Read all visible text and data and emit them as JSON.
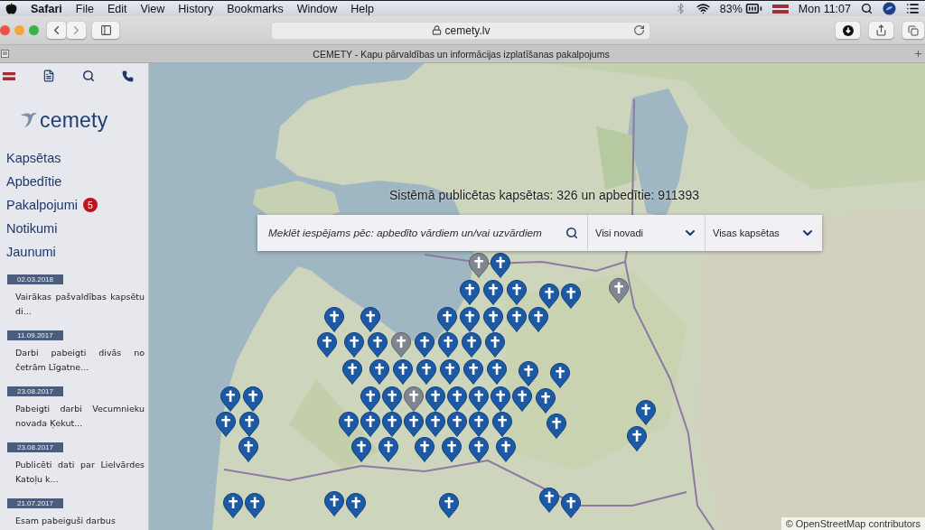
{
  "menu_bar": {
    "app": "Safari",
    "menus": [
      "File",
      "Edit",
      "View",
      "History",
      "Bookmarks",
      "Window",
      "Help"
    ],
    "battery": "83%",
    "clock": "Mon 11:07"
  },
  "toolbar": {
    "address": "cemety.lv"
  },
  "tab": {
    "title": "CEMETY - Kapu pārvaldības un informācijas izplatīšanas pakalpojums"
  },
  "sidebar": {
    "logo": "cemety",
    "nav": [
      {
        "label": "Kapsētas"
      },
      {
        "label": "Apbedītie"
      },
      {
        "label": "Pakalpojumi",
        "badge": "5"
      },
      {
        "label": "Notikumi"
      },
      {
        "label": "Jaunumi"
      }
    ],
    "news": [
      {
        "date": "02.03.2018",
        "text": "Vairākas pašvaldības kapsētu di..."
      },
      {
        "date": "11.09.2017",
        "text": "Darbi pabeigti divās no četrām Līgatne..."
      },
      {
        "date": "23.08.2017",
        "text": "Pabeigti darbi Vecumnieku novada Ķekut..."
      },
      {
        "date": "23.08.2017",
        "text": "Publicēti dati par Lielvārdes Katoļu k..."
      },
      {
        "date": "21.07.2017",
        "text": "Esam pabeiguši darbus"
      }
    ]
  },
  "map": {
    "summary": "Sistēmā publicētas kapsētas: 326 un apbedītie: 911393",
    "search": {
      "placeholder": "Meklēt iespējams pēc: apbedīto vārdiem un/vai uzvārdiem"
    },
    "filters": [
      {
        "label": "Visi novadi"
      },
      {
        "label": "Visas kapsētas"
      }
    ],
    "attribution": "© OpenStreetMap contributors"
  }
}
